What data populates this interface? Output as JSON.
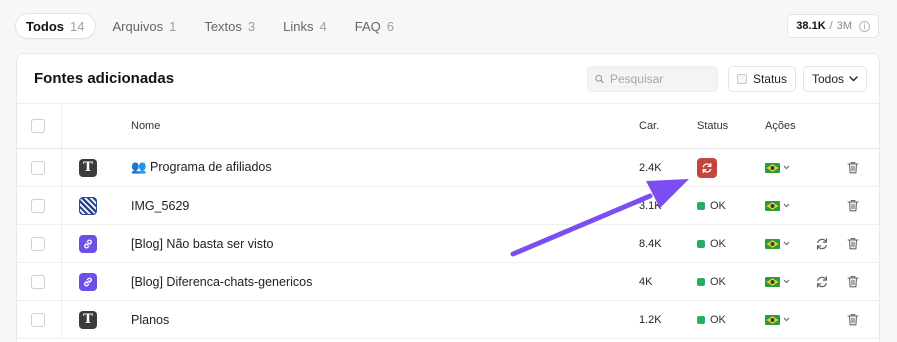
{
  "tabs": [
    {
      "label": "Todos",
      "count": "14",
      "active": true
    },
    {
      "label": "Arquivos",
      "count": "1"
    },
    {
      "label": "Textos",
      "count": "3"
    },
    {
      "label": "Links",
      "count": "4"
    },
    {
      "label": "FAQ",
      "count": "6"
    }
  ],
  "quota": {
    "used": "38.1K",
    "separator": "/",
    "total": "3M"
  },
  "card": {
    "title": "Fontes adicionadas",
    "search_placeholder": "Pesquisar",
    "status_filter_label": "Status",
    "select_value": "Todos"
  },
  "table": {
    "headers": {
      "name": "Nome",
      "chars": "Car.",
      "status": "Status",
      "actions": "Ações"
    },
    "rows": [
      {
        "type": "text-icon",
        "name": "👥 Programa de afiliados",
        "chars": "2.4K",
        "status": "error",
        "status_label": "",
        "sync": false
      },
      {
        "type": "image-icon",
        "name": "IMG_5629",
        "chars": "3.1K",
        "status": "ok",
        "status_label": "OK",
        "sync": false
      },
      {
        "type": "link-icon",
        "name": "[Blog] Não basta ser visto",
        "chars": "8.4K",
        "status": "ok",
        "status_label": "OK",
        "sync": true
      },
      {
        "type": "link-icon",
        "name": "[Blog] Diferenca-chats-genericos",
        "chars": "4K",
        "status": "ok",
        "status_label": "OK",
        "sync": true
      },
      {
        "type": "text-icon",
        "name": "Planos",
        "chars": "1.2K",
        "status": "ok",
        "status_label": "OK",
        "sync": false
      }
    ]
  },
  "colors": {
    "accent_purple": "#7c4df0",
    "ok_green": "#27ae60",
    "error_red": "#c6443c"
  }
}
